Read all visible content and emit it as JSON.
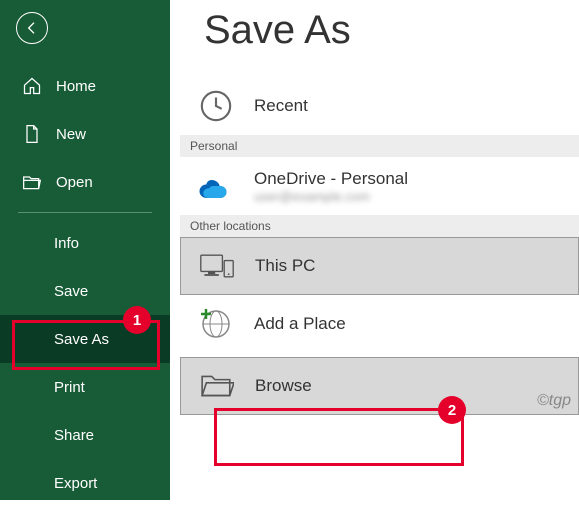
{
  "sidebar": {
    "home": "Home",
    "new": "New",
    "open": "Open",
    "info": "Info",
    "save": "Save",
    "saveAs": "Save As",
    "print": "Print",
    "share": "Share",
    "export": "Export"
  },
  "main": {
    "title": "Save As",
    "recent": "Recent",
    "personalLabel": "Personal",
    "onedrive": "OneDrive - Personal",
    "onedriveEmail": "user@example.com",
    "otherLabel": "Other locations",
    "thisPC": "This PC",
    "addPlace": "Add a Place",
    "browse": "Browse"
  },
  "annotations": {
    "badge1": "1",
    "badge2": "2",
    "watermark": "©tgp"
  }
}
